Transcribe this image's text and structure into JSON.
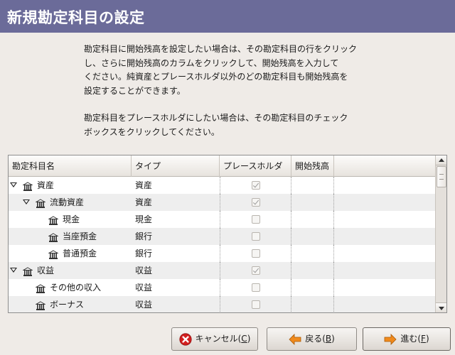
{
  "header": {
    "title": "新規勘定科目の設定"
  },
  "intro": {
    "p1": "勘定科目に開始残高を設定したい場合は、その勘定科目の行をクリック\nし、さらに開始残高のカラムをクリックして、開始残高を入力して\nください。純資産とプレースホルダ以外のどの勘定科目も開始残高を\n設定することができます。",
    "p2": "勘定科目をプレースホルダにしたい場合は、その勘定科目のチェック\nボックスをクリックしてください。"
  },
  "table": {
    "columns": {
      "name": "勘定科目名",
      "type": "タイプ",
      "placeholder": "プレースホルダ",
      "opening_balance": "開始残高"
    },
    "rows": [
      {
        "name": "資産",
        "type": "資産",
        "placeholder": true,
        "expanded": true,
        "level": 0
      },
      {
        "name": "流動資産",
        "type": "資産",
        "placeholder": true,
        "expanded": true,
        "level": 1
      },
      {
        "name": "現金",
        "type": "現金",
        "placeholder": false,
        "level": 2
      },
      {
        "name": "当座預金",
        "type": "銀行",
        "placeholder": false,
        "level": 2
      },
      {
        "name": "普通預金",
        "type": "銀行",
        "placeholder": false,
        "level": 2
      },
      {
        "name": "収益",
        "type": "収益",
        "placeholder": true,
        "expanded": true,
        "level": 0
      },
      {
        "name": "その他の収入",
        "type": "収益",
        "placeholder": false,
        "level": 1
      },
      {
        "name": "ボーナス",
        "type": "収益",
        "placeholder": false,
        "level": 1
      }
    ]
  },
  "buttons": {
    "cancel": {
      "label": "キャンセル(",
      "mnemonic": "C",
      "suffix": ")"
    },
    "back": {
      "label": "戻る(",
      "mnemonic": "B",
      "suffix": ")"
    },
    "next": {
      "label": "進む(",
      "mnemonic": "F",
      "suffix": ")"
    }
  },
  "colors": {
    "header_bg": "#6b6b99",
    "cancel_icon": "#d21f1f",
    "arrow_icon": "#f08a1c"
  },
  "icons": {
    "account": "bank-icon",
    "expander": "triangle-down-icon",
    "cancel": "cancel-icon",
    "back": "arrow-left-icon",
    "next": "arrow-right-icon"
  }
}
